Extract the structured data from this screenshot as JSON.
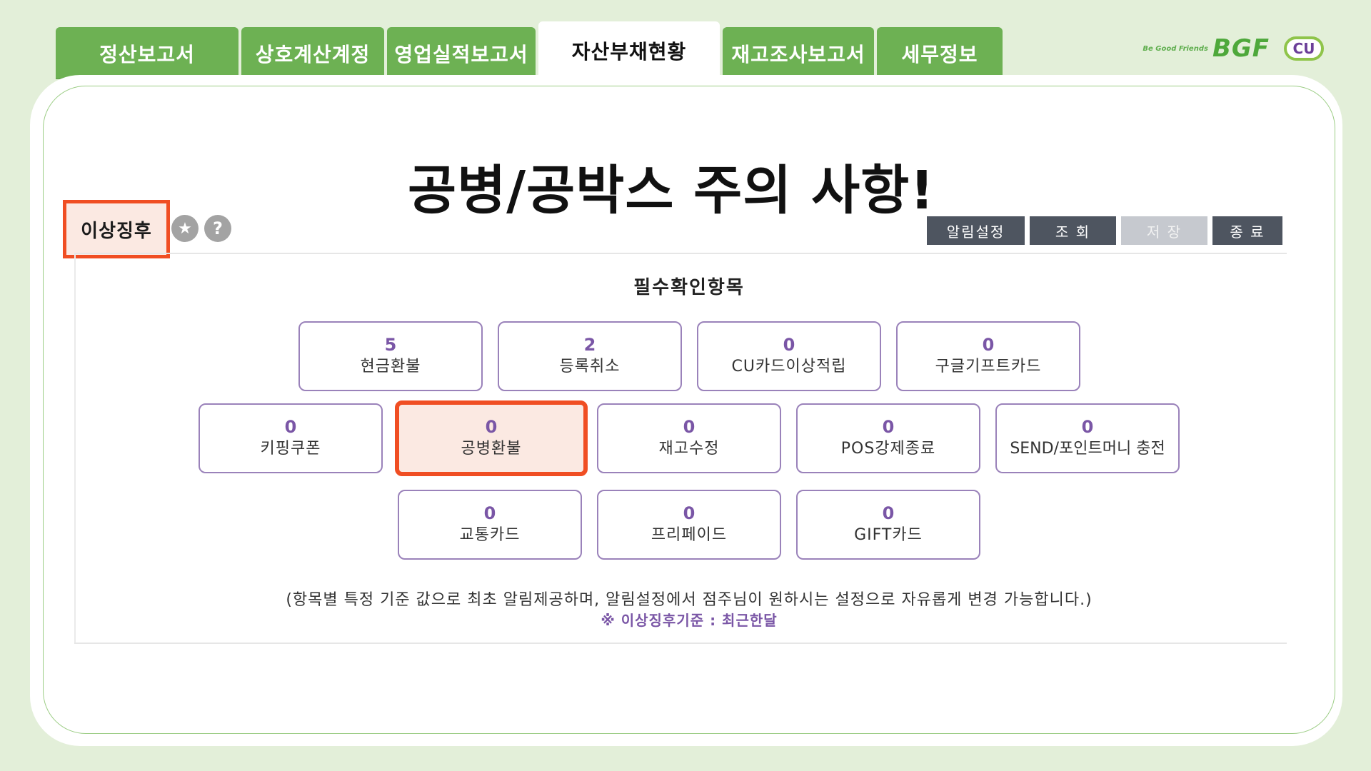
{
  "tabs": [
    {
      "label": "정산보고서",
      "active": false
    },
    {
      "label": "상호계산계정",
      "active": false
    },
    {
      "label": "영업실적보고서",
      "active": false
    },
    {
      "label": "자산부채현황",
      "active": true
    },
    {
      "label": "재고조사보고서",
      "active": false
    },
    {
      "label": "세무정보",
      "active": false
    }
  ],
  "logo": {
    "tagline": "Be Good Friends",
    "brand": "BGF",
    "mark": "CU"
  },
  "headline": "공병/공박스 주의 사항!",
  "screen": {
    "title": "이상징후"
  },
  "toolbar": {
    "alert_settings": "알림설정",
    "search": "조 회",
    "save": "저 장",
    "close": "종 료"
  },
  "section_title": "필수확인항목",
  "items": [
    {
      "count": "5",
      "label": "현금환불"
    },
    {
      "count": "2",
      "label": "등록취소"
    },
    {
      "count": "0",
      "label": "CU카드이상적립"
    },
    {
      "count": "0",
      "label": "구글기프트카드"
    },
    {
      "count": "0",
      "label": "키핑쿠폰"
    },
    {
      "count": "0",
      "label": "공병환불",
      "highlighted": true
    },
    {
      "count": "0",
      "label": "재고수정"
    },
    {
      "count": "0",
      "label": "POS강제종료"
    },
    {
      "count": "0",
      "label": "SEND/포인트머니 충전"
    },
    {
      "count": "0",
      "label": "교통카드"
    },
    {
      "count": "0",
      "label": "프리페이드"
    },
    {
      "count": "0",
      "label": "GIFT카드"
    }
  ],
  "note": "(항목별 특정 기준 값으로 최초 알림제공하며, 알림설정에서 점주님이 원하시는 설정으로 자유롭게 변경 가능합니다.)",
  "note_sub": "※ 이상징후기준 : 최근한달",
  "colors": {
    "background": "#e3efd9",
    "tab_green": "#6db153",
    "highlight_orange": "#f04e23",
    "item_purple": "#7a56a6",
    "toolbar_dark": "#4e5560"
  },
  "icons": {
    "favorite": "star-icon",
    "help": "help-icon"
  }
}
